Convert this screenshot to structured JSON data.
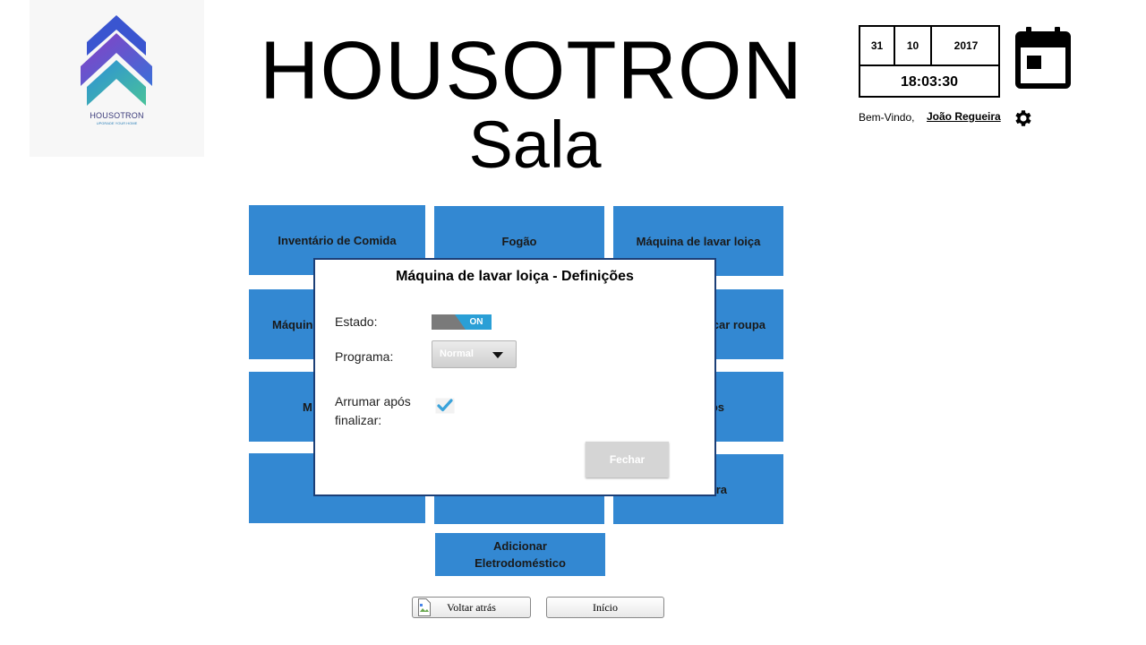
{
  "app": {
    "title": "HOUSOTRON",
    "room": "Sala",
    "logo_word": "HOUSOTRON",
    "logo_tagline": "UPGRADE YOUR HOME"
  },
  "datetime": {
    "day": "31",
    "month": "10",
    "year": "2017",
    "time": "18:03:30"
  },
  "user": {
    "welcome": "Bem-Vindo,",
    "name": "João Regueira"
  },
  "tiles": [
    "Inventário de Comida",
    "Fogão",
    "Máquina de lavar loiça",
    "Máquin",
    "car roupa",
    "M",
    "os",
    "",
    "",
    "ra"
  ],
  "add_tile": "Adicionar Eletrodoméstico",
  "dialog": {
    "title": "Máquina de lavar loiça - Definições",
    "estado_label": "Estado:",
    "estado_value": "ON",
    "programa_label": "Programa:",
    "programa_value": "Normal",
    "arrumar_label": "Arrumar após finalizar:",
    "arrumar_checked": true,
    "close_label": "Fechar"
  },
  "nav": {
    "back_label": "Voltar atrás",
    "home_label": "Início"
  },
  "colors": {
    "tile": "#3388d2",
    "dialog_border": "#1c3f77",
    "toggle_on": "#2a9fd6"
  },
  "icons": [
    "calendar-icon",
    "gear-icon",
    "check-icon",
    "chevron-down-icon",
    "broken-image-icon"
  ]
}
